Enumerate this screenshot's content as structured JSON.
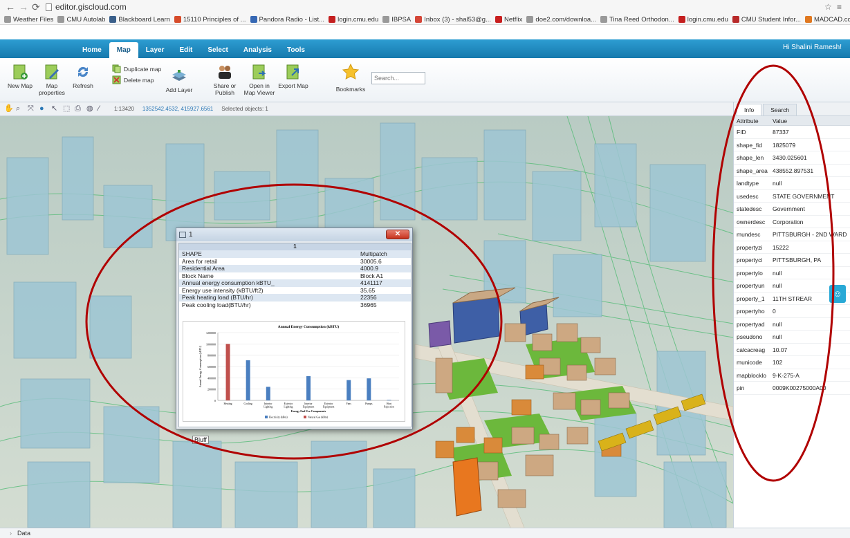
{
  "browser": {
    "url": "editor.giscloud.com",
    "bookmarks": [
      {
        "label": "Weather Files",
        "color": "#999999"
      },
      {
        "label": "CMU Autolab",
        "color": "#999999"
      },
      {
        "label": "Blackboard Learn",
        "color": "#3a5f8a"
      },
      {
        "label": "15110 Principles of ...",
        "color": "#d64b2a"
      },
      {
        "label": "Pandora Radio - List...",
        "color": "#3668b4"
      },
      {
        "label": "login.cmu.edu",
        "color": "#c41f1f"
      },
      {
        "label": "IBPSA",
        "color": "#999999"
      },
      {
        "label": "Inbox (3) - shal53@g...",
        "color": "#d44638"
      },
      {
        "label": "Netflix",
        "color": "#c81f1f"
      },
      {
        "label": "doe2.com/downloa...",
        "color": "#999999"
      },
      {
        "label": "Tina Reed Orthodon...",
        "color": "#999999"
      },
      {
        "label": "login.cmu.edu",
        "color": "#c41f1f"
      },
      {
        "label": "CMU Student Infor...",
        "color": "#b82a2a"
      },
      {
        "label": "MADCAD.com - Th...",
        "color": "#e07820"
      },
      {
        "label": "Google Scholar",
        "color": "#3c7bd9"
      }
    ]
  },
  "app": {
    "tabs": [
      "Home",
      "Map",
      "Layer",
      "Edit",
      "Select",
      "Analysis",
      "Tools"
    ],
    "active_tab": "Map",
    "greeting": "Hi Shalini Ramesh!",
    "ribbon": {
      "new_map": "New Map",
      "map_properties": "Map properties",
      "refresh": "Refresh",
      "duplicate_map": "Duplicate map",
      "delete_map": "Delete map",
      "add_layer": "Add Layer",
      "share_publish": "Share or Publish",
      "open_viewer": "Open in Map Viewer",
      "export_map": "Export Map",
      "bookmarks": "Bookmarks",
      "search_placeholder": "Search..."
    },
    "toolbar": {
      "scale": "1:13420",
      "coords": "1352542.4532, 415927.6561",
      "selected": "Selected objects: 1"
    },
    "statusbar": "Data",
    "map_label": "Bluff"
  },
  "popup": {
    "title": "1",
    "header": "1",
    "rows": [
      {
        "k": "SHAPE",
        "v": "Multipatch"
      },
      {
        "k": "Area for retail",
        "v": "30005.6"
      },
      {
        "k": "Residential Area",
        "v": "4000.9"
      },
      {
        "k": "Block Name",
        "v": "Block A1"
      },
      {
        "k": "Annual energy consumption kBTU_",
        "v": "4141117"
      },
      {
        "k": "Energy use intensity (kBTU/ft2)",
        "v": "35.65"
      },
      {
        "k": "Peak heating load (BTU/hr)",
        "v": "22356"
      },
      {
        "k": "Peak cooling load(BTU/hr)",
        "v": "36965"
      }
    ]
  },
  "chart_data": {
    "type": "bar",
    "title": "Annual Energy Consumption (kBTU)",
    "xlabel": "Energy End Use Components",
    "ylabel": "Annual Energy Consumption (kBTU)",
    "ylim": [
      0,
      1200000
    ],
    "yticks": [
      "0",
      "200000",
      "400000",
      "600000",
      "800000",
      "1000000",
      "1200000"
    ],
    "categories": [
      "Heating",
      "Cooling",
      "Interior Lighting",
      "Exterior Lighting",
      "Interior Equipment",
      "Exterior Equipment",
      "Fans",
      "Pumps",
      "Heat Rejection"
    ],
    "series": [
      {
        "name": "Electricity (kBtu)",
        "color": "#4a7fc0",
        "values": [
          0,
          710000,
          240000,
          0,
          430000,
          0,
          360000,
          390000,
          10000
        ]
      },
      {
        "name": "Natural Gas (kBtu)",
        "color": "#c0504d",
        "values": [
          1000000,
          0,
          0,
          0,
          0,
          0,
          0,
          0,
          0
        ]
      }
    ],
    "legend": "bottom"
  },
  "side": {
    "tabs": [
      "Info",
      "Search"
    ],
    "col_attr": "Attribute",
    "col_val": "Value",
    "rows": [
      {
        "k": "FID",
        "v": "87337"
      },
      {
        "k": "shape_fid",
        "v": "1825079"
      },
      {
        "k": "shape_len",
        "v": "3430.025601"
      },
      {
        "k": "shape_area",
        "v": "438552.897531"
      },
      {
        "k": "landtype",
        "v": "null"
      },
      {
        "k": "usedesc",
        "v": "STATE GOVERNMENT"
      },
      {
        "k": "statedesc",
        "v": "Government"
      },
      {
        "k": "ownerdesc",
        "v": "Corporation"
      },
      {
        "k": "mundesc",
        "v": "PITTSBURGH - 2ND WARD"
      },
      {
        "k": "propertyzi",
        "v": "15222"
      },
      {
        "k": "propertyci",
        "v": "PITTSBURGH, PA"
      },
      {
        "k": "propertylo",
        "v": "null"
      },
      {
        "k": "propertyun",
        "v": "null"
      },
      {
        "k": "property_1",
        "v": "11TH STREAR"
      },
      {
        "k": "propertyho",
        "v": "0"
      },
      {
        "k": "propertyad",
        "v": "null"
      },
      {
        "k": "pseudono",
        "v": "null"
      },
      {
        "k": "calcacreag",
        "v": "10.07"
      },
      {
        "k": "municode",
        "v": "102"
      },
      {
        "k": "mapblocklo",
        "v": "9-K-275-A"
      },
      {
        "k": "pin",
        "v": "0009K00275000A00"
      }
    ]
  },
  "colors": {
    "header_blue": "#1f8cc4",
    "annotation_red": "#b00000",
    "building_glass": "#9ec6d4",
    "building_orange": "#d98a3a",
    "building_yellow": "#d9b21a"
  }
}
